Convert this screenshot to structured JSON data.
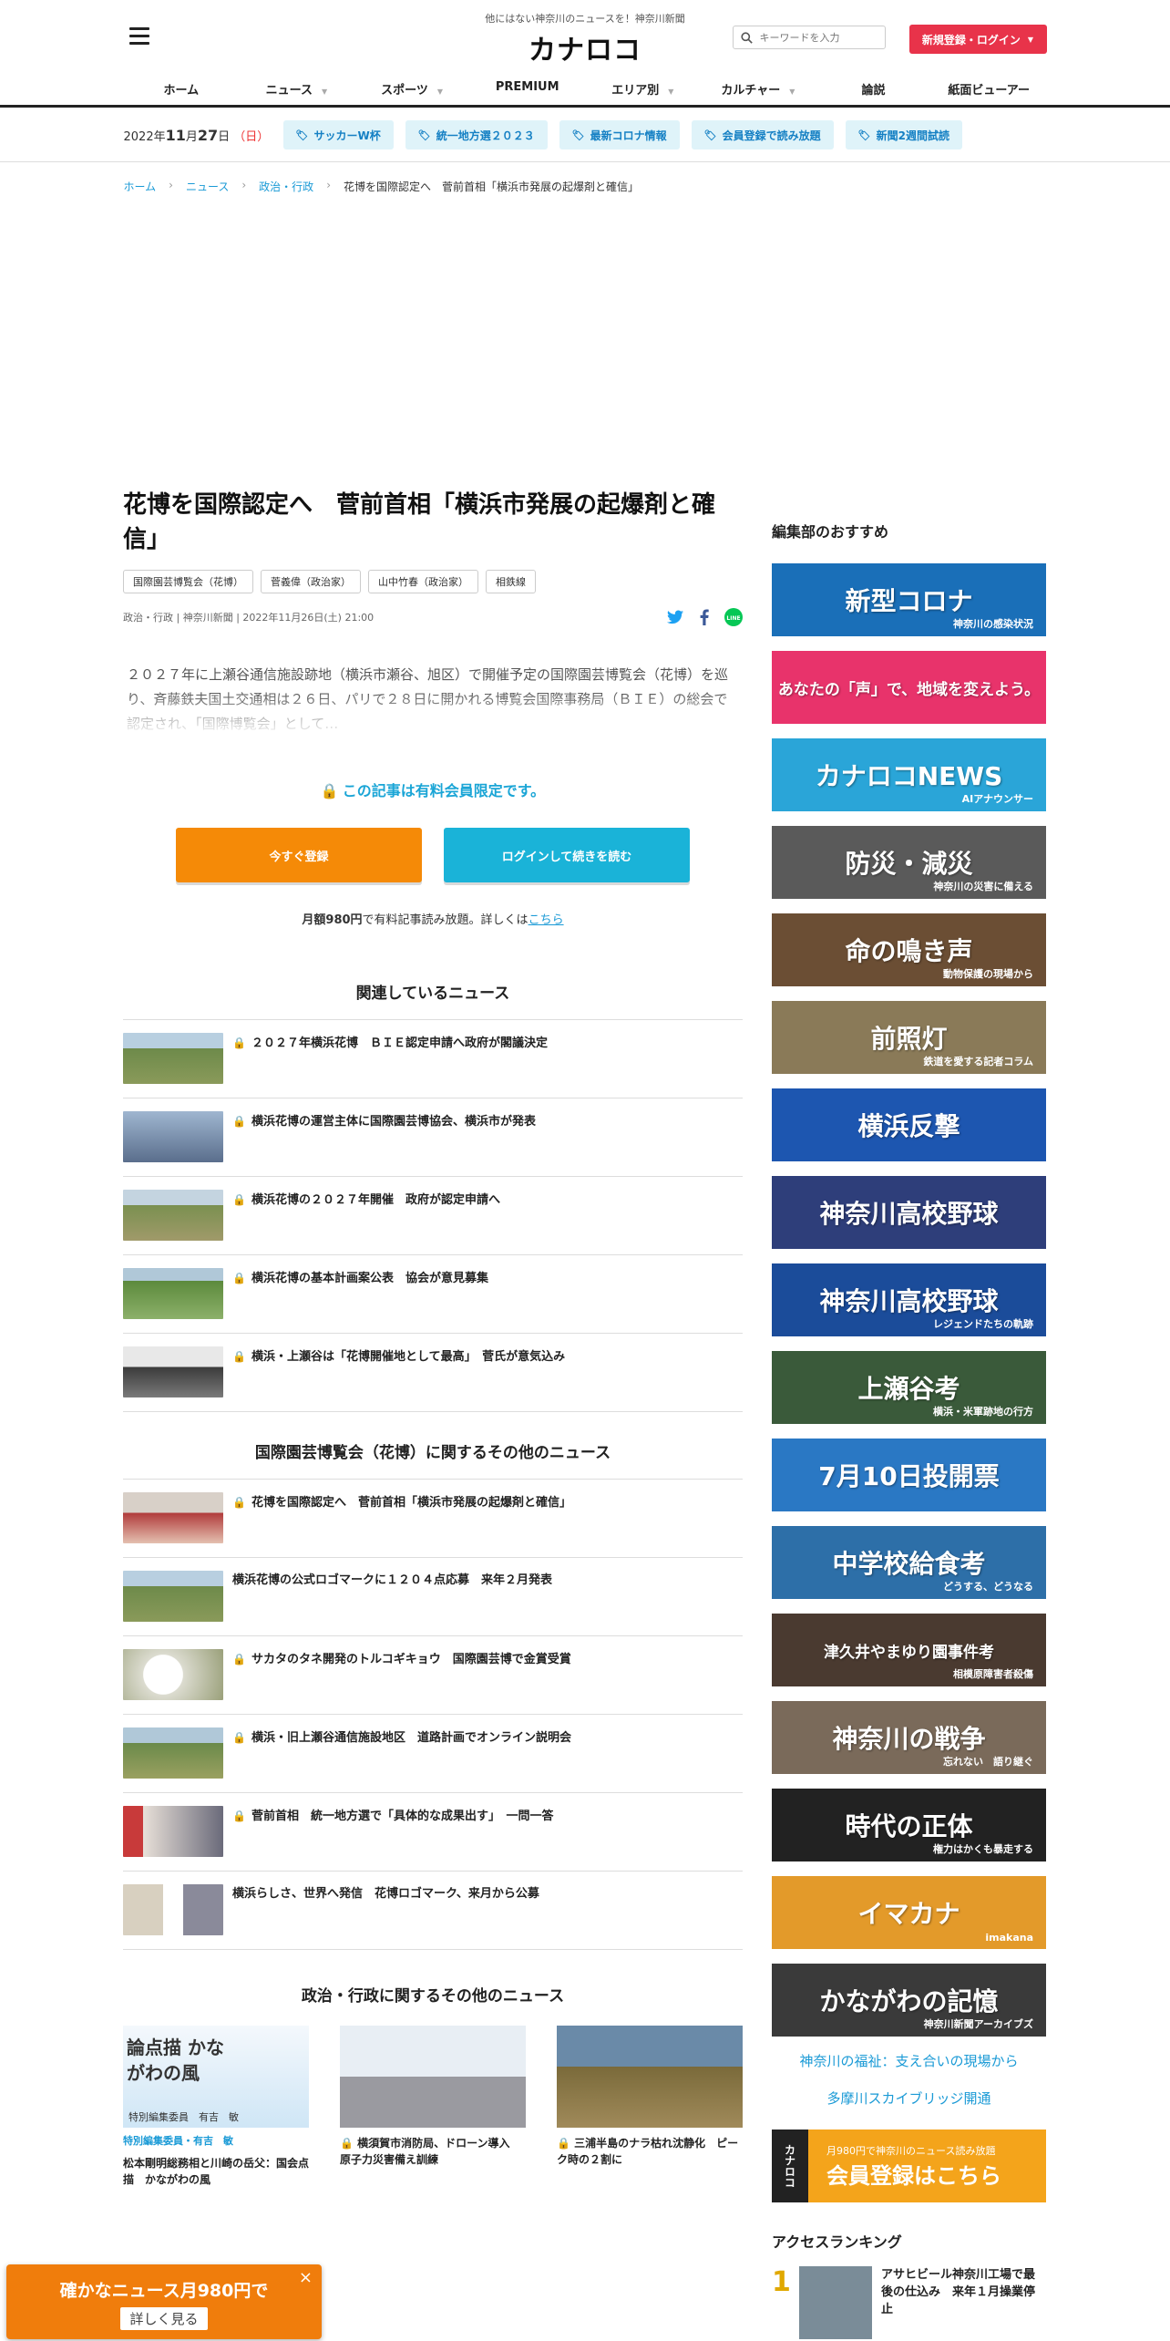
{
  "header": {
    "tagline": "他にはない神奈川のニュースを！神奈川新聞",
    "logo": "カナロコ",
    "search_placeholder": "キーワードを入力",
    "login_label": "新規登録・ログイン",
    "nav": [
      "ホーム",
      "ニュース",
      "スポーツ",
      "PREMIUM",
      "エリア別",
      "カルチャー",
      "論説",
      "紙面ビューアー"
    ],
    "nav_has_caret": [
      false,
      true,
      true,
      false,
      true,
      true,
      false,
      false
    ]
  },
  "datebar": {
    "date_year": "2022年",
    "date_month": "11",
    "date_day": "27",
    "date_weekday": "（日）",
    "tags": [
      "サッカーW杯",
      "統一地方選２０２３",
      "最新コロナ情報",
      "会員登録で読み放題",
      "新聞2週間試読"
    ]
  },
  "breadcrumb": [
    "ホーム",
    "ニュース",
    "政治・行政",
    "花博を国際認定へ　菅前首相「横浜市発展の起爆剤と確信」"
  ],
  "article": {
    "title": "花博を国際認定へ　菅前首相「横浜市発展の起爆剤と確信」",
    "tags": [
      "国際園芸博覧会（花博）",
      "菅義偉（政治家）",
      "山中竹春（政治家）",
      "相鉄線"
    ],
    "meta": "政治・行政 | 神奈川新聞 | 2022年11月26日(土) 21:00",
    "lead": "２０２７年に上瀬谷通信施設跡地（横浜市瀬谷、旭区）で開催予定の国際園芸博覧会（花博）を巡り、斉藤鉄夫国土交通相は２６日、パリで２８日に開かれる博覧会国際事務局（ＢＩＥ）の総会で認定され、「国際博覧会」として…",
    "paid_notice": "この記事は有料会員限定です。",
    "register_btn": "今すぐ登録",
    "login_btn": "ログインして続きを読む",
    "price_bold": "月額980円",
    "price_text": "で有料記事読み放題。詳しくは",
    "price_link": "こちら"
  },
  "related": {
    "heading": "関連しているニュース",
    "items": [
      {
        "text": "２０２７年横浜花博　ＢＩＥ認定申請へ政府が閣議決定",
        "locked": true
      },
      {
        "text": "横浜花博の運営主体に国際園芸博協会、横浜市が発表",
        "locked": true
      },
      {
        "text": "横浜花博の２０２７年開催　政府が認定申請へ",
        "locked": true
      },
      {
        "text": "横浜花博の基本計画案公表　協会が意見募集",
        "locked": true
      },
      {
        "text": "横浜・上瀬谷は「花博開催地として最高」　菅氏が意気込み",
        "locked": true
      }
    ]
  },
  "expo": {
    "heading": "国際園芸博覧会（花博）に関するその他のニュース",
    "items": [
      {
        "text": "花博を国際認定へ　菅前首相「横浜市発展の起爆剤と確信」",
        "locked": true
      },
      {
        "text": "横浜花博の公式ロゴマークに１２０４点応募　来年２月発表",
        "locked": false
      },
      {
        "text": "サカタのタネ開発のトルコギキョウ　国際園芸博で金賞受賞",
        "locked": true
      },
      {
        "text": "横浜・旧上瀬谷通信施設地区　道路計画でオンライン説明会",
        "locked": true
      },
      {
        "text": "菅前首相　統一地方選で「具体的な成果出す」　一問一答",
        "locked": true
      },
      {
        "text": "横浜らしさ、世界へ発信　花博ロゴマーク、来月から公募",
        "locked": false
      }
    ]
  },
  "politics": {
    "heading": "政治・行政に関するその他のニュース",
    "cards": [
      {
        "img_text": "論点描 かながわの風",
        "sub": "特別編集委員　有吉　敏",
        "author": "特別編集委員・有吉　敏",
        "text": "松本剛明総務相と川崎の岳父：国会点描　かながわの風"
      },
      {
        "img_text": "",
        "sub": "",
        "author": "",
        "text": "横須賀市消防局、ドローン導入　原子力災害備え訓練",
        "locked": true
      },
      {
        "img_text": "",
        "sub": "",
        "author": "",
        "text": "三浦半島のナラ枯れ沈静化　ピーク時の２割に",
        "locked": true
      }
    ]
  },
  "sidebar": {
    "heading": "編集部のおすすめ",
    "banners": [
      {
        "title": "新型コロナ",
        "sub": "神奈川の感染状況",
        "color": "#1a6fb8"
      },
      {
        "title": "あなたの「声」で、地域を変えよう。",
        "sub": "",
        "color": "#e8336b"
      },
      {
        "title": "カナロコNEWS",
        "sub": "AIアナウンサー",
        "color": "#2aa5d8"
      },
      {
        "title": "防災・減災",
        "sub": "神奈川の災害に備える",
        "color": "#5a5a5a"
      },
      {
        "title": "命の鳴き声",
        "sub": "動物保護の現場から",
        "color": "#6b4e34"
      },
      {
        "title": "前照灯",
        "sub": "鉄道を愛する記者コラム",
        "color": "#8a7a58"
      },
      {
        "title": "横浜反撃",
        "sub": "",
        "color": "#1d56b0"
      },
      {
        "title": "神奈川高校野球",
        "sub": "",
        "color": "#2e3e7a"
      },
      {
        "title": "神奈川高校野球",
        "sub": "レジェンドたちの軌跡",
        "color": "#1b4c9a"
      },
      {
        "title": "上瀬谷考",
        "sub": "横浜・米軍跡地の行方",
        "color": "#3a5a3a"
      },
      {
        "title": "7月10日投開票",
        "sub": "",
        "color": "#2a78c4"
      },
      {
        "title": "中学校給食考",
        "sub": "どうする、どうなる",
        "color": "#2d6fa8"
      },
      {
        "title": "津久井やまゆり園事件考",
        "sub": "相模原障害者殺傷",
        "color": "#4a3a30"
      },
      {
        "title": "神奈川の戦争",
        "sub": "忘れない　語り継ぐ",
        "color": "#7a6a5a"
      },
      {
        "title": "時代の正体",
        "sub": "権力はかくも暴走する",
        "color": "#222222"
      },
      {
        "title": "イマカナ",
        "sub": "imakana",
        "color": "#e39a2a"
      },
      {
        "title": "かながわの記憶",
        "sub": "神奈川新聞アーカイブズ",
        "color": "#3a3a3a"
      }
    ],
    "links": [
      "神奈川の福祉：支え合いの現場から",
      "多摩川スカイブリッジ開通"
    ],
    "member_logo": "カナロコ",
    "member_small": "月980円で神奈川のニュース読み放題",
    "member_big": "会員登録はこちら",
    "ranking_heading": "アクセスランキング",
    "ranking": [
      {
        "num": "1",
        "text": "アサヒビール神奈川工場で最後の仕込み　来年１月操業停止"
      }
    ]
  },
  "promo": {
    "title": "確かなニュース月980円で",
    "button": "詳しく見る",
    "close": "×"
  }
}
